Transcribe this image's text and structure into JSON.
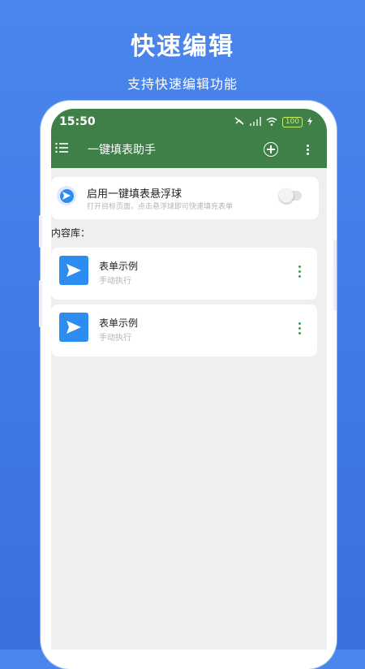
{
  "promo": {
    "headline": "快速编辑",
    "subline": "支持快速编辑功能"
  },
  "status_bar": {
    "time": "15:50",
    "battery": "100"
  },
  "app_bar": {
    "title": "一键填表助手",
    "color": "#3f8048"
  },
  "floating_ball": {
    "title": "启用一键填表悬浮球",
    "description": "打开目标页面，点击悬浮球即可快速填充表单",
    "enabled": false
  },
  "library": {
    "label": "内容库：",
    "items": [
      {
        "title": "表单示例",
        "subtitle": "手动执行"
      },
      {
        "title": "表单示例",
        "subtitle": "手动执行"
      }
    ]
  },
  "colors": {
    "accent": "#2d8cf0",
    "background": "#4a86ec"
  }
}
